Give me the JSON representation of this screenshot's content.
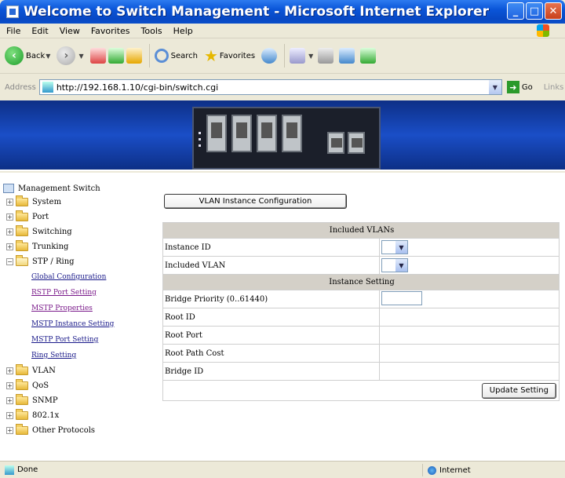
{
  "window": {
    "title": "Welcome to Switch Management - Microsoft Internet Explorer",
    "buttons": [
      "minimize",
      "maximize",
      "close"
    ]
  },
  "menu": [
    "File",
    "Edit",
    "View",
    "Favorites",
    "Tools",
    "Help"
  ],
  "toolbar": {
    "back_label": "Back",
    "search_label": "Search",
    "favorites_label": "Favorites"
  },
  "address": {
    "label": "Address",
    "url": "http://192.168.1.10/cgi-bin/switch.cgi",
    "go_label": "Go",
    "links_label": "Links"
  },
  "sidebar": {
    "root": "Management Switch",
    "items": [
      {
        "label": "System"
      },
      {
        "label": "Port"
      },
      {
        "label": "Switching"
      },
      {
        "label": "Trunking"
      },
      {
        "label": "STP / Ring"
      }
    ],
    "stp_links": [
      "Global Configuration",
      "RSTP Port Setting",
      "MSTP Properties",
      "MSTP Instance Setting",
      "MSTP Port Setting",
      "Ring Setting"
    ],
    "items_after": [
      {
        "label": "VLAN"
      },
      {
        "label": "QoS"
      },
      {
        "label": "SNMP"
      },
      {
        "label": "802.1x"
      },
      {
        "label": "Other Protocols"
      }
    ]
  },
  "main": {
    "vlan_button": "VLAN Instance Configuration",
    "included_header": "Included VLANs",
    "instance_id_label": "Instance ID",
    "included_vlan_label": "Included VLAN",
    "instance_setting_header": "Instance Setting",
    "bridge_priority_label": "Bridge Priority (0..61440)",
    "root_id_label": "Root ID",
    "root_port_label": "Root Port",
    "root_path_cost_label": "Root Path Cost",
    "bridge_id_label": "Bridge ID",
    "update_button": "Update Setting"
  },
  "status": {
    "text": "Done",
    "zone": "Internet"
  }
}
